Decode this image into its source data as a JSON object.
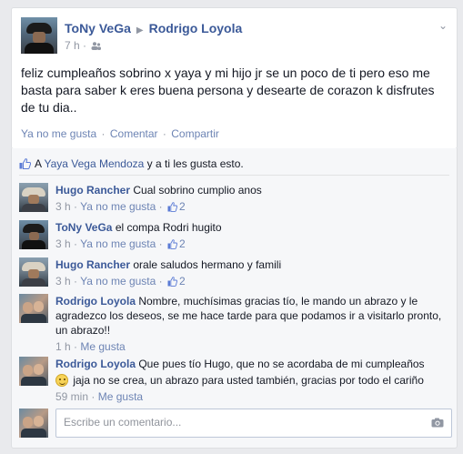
{
  "post": {
    "author": "ToNy VeGa",
    "recipient": "Rodrigo Loyola",
    "time": "7 h",
    "text": "feliz cumpleaños sobrino x yaya y mi hijo jr se un poco de ti pero eso me basta para saber k eres buena persona y desearte de corazon k disfrutes de tu dia..",
    "actions": {
      "like": "Ya no me gusta",
      "comment": "Comentar",
      "share": "Compartir"
    }
  },
  "likes": {
    "prefix": "A",
    "names": "Yaya Vega Mendoza",
    "suffix": "y a ti les gusta esto."
  },
  "comments": [
    {
      "author": "Hugo Rancher",
      "text": "Cual sobrino cumplio anos",
      "time": "3 h",
      "action": "Ya no me gusta",
      "likes": "2"
    },
    {
      "author": "ToNy VeGa",
      "text": "el compa Rodri hugito",
      "time": "3 h",
      "action": "Ya no me gusta",
      "likes": "2"
    },
    {
      "author": "Hugo Rancher",
      "text": "orale saludos hermano y famili",
      "time": "3 h",
      "action": "Ya no me gusta",
      "likes": "2"
    },
    {
      "author": "Rodrigo Loyola",
      "text": "Nombre, muchísimas gracias tío, le mando un abrazo y le agradezco los deseos, se me hace tarde para que podamos ir a visitarlo pronto, un abrazo!!",
      "time": "1 h",
      "action": "Me gusta"
    },
    {
      "author": "Rodrigo Loyola",
      "text_1": "Que pues tío Hugo, que no se acordaba de mi cumpleaños",
      "text_2": "jaja no se crea, un abrazo para usted también, gracias por todo el cariño",
      "time": "59 min",
      "action": "Me gusta"
    }
  ],
  "composer": {
    "placeholder": "Escribe un comentario..."
  },
  "meta_sep": "·",
  "colors": {
    "link": "#3b5998",
    "muted": "#9197a3",
    "background": "#e9eaed"
  }
}
